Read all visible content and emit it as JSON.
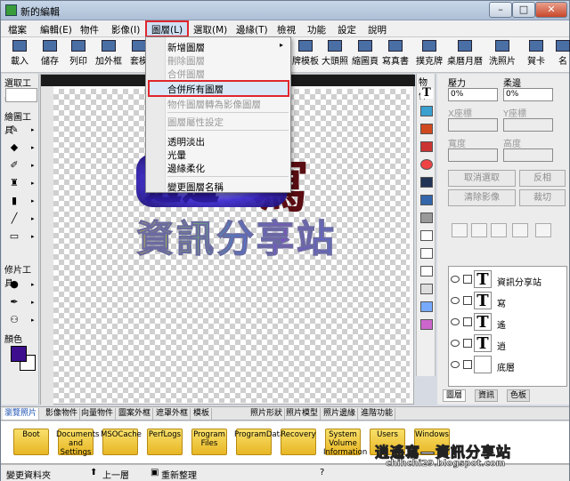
{
  "window": {
    "title": "新的編輯"
  },
  "menubar": [
    "檔案",
    "編輯(E)",
    "物件",
    "影像(I)",
    "圖層(L)",
    "選取(M)",
    "邊緣(T)",
    "檢視",
    "功能",
    "設定",
    "說明"
  ],
  "toolbar": [
    "載入",
    "儲存",
    "列印",
    "加外框",
    "套模",
    "牌模板",
    "大頭照",
    "縮圖頁",
    "寫真書",
    "撲克牌",
    "桌曆月曆",
    "洗照片",
    "賀卡",
    "名"
  ],
  "left_panel": {
    "select_title": "選取工具",
    "paint_title": "繪圖工具",
    "retouch_title": "修片工具",
    "color_title": "顏色"
  },
  "dropdown": {
    "items": [
      {
        "label": "新增圖層",
        "disabled": false,
        "submenu": true
      },
      {
        "label": "刪除圖層",
        "disabled": true
      },
      {
        "label": "合併圖層",
        "disabled": true
      },
      {
        "label": "合併所有圖層",
        "disabled": false,
        "highlighted": true
      },
      {
        "label": "物件圖層轉為影像圖層",
        "disabled": true
      },
      {
        "label": "圖層屬性設定",
        "disabled": true
      },
      {
        "label": "透明淡出",
        "disabled": false
      },
      {
        "label": "光暈",
        "disabled": false
      },
      {
        "label": "邊緣柔化",
        "disabled": false
      },
      {
        "label": "變更圖層名稱",
        "disabled": false
      }
    ]
  },
  "canvas": {
    "text": "資訊分享站",
    "shadow_glyph": "寫"
  },
  "side_icons": {
    "label": "物件"
  },
  "right_panel": {
    "opacity_label": "壓力",
    "opacity_val": "0%",
    "soft_label": "柔邊",
    "soft_val": "0%",
    "x_label": "X座標",
    "y_label": "Y座標",
    "w_label": "寬度",
    "h_label": "高度",
    "cancel_sel": "取消選取",
    "flip": "反相",
    "clear_img": "清除影像",
    "crop": "裁切",
    "layers": [
      {
        "name": "資訊分享站",
        "thumb": "T"
      },
      {
        "name": "寫",
        "thumb": "T"
      },
      {
        "name": "遙",
        "thumb": "T"
      },
      {
        "name": "逍",
        "thumb": "T"
      },
      {
        "name": "底層",
        "thumb": ""
      }
    ],
    "tabs": [
      "圖層",
      "資訊",
      "色板"
    ]
  },
  "bottom_tabs": [
    "瀏覽照片",
    "影像物件",
    "向量物件",
    "圖案外框",
    "遮罩外框",
    "模板",
    "照片形狀",
    "照片模型",
    "照片邊緣",
    "進階功能"
  ],
  "folders": [
    "Boot",
    "Documents and Settings",
    "MSOCache",
    "PerfLogs",
    "Program Files",
    "ProgramData",
    "Recovery",
    "System Volume Information",
    "Users",
    "Windows"
  ],
  "statusbar": {
    "left": "變更資料夾",
    "up": "上一層",
    "refresh": "重新整理",
    "q": "?"
  },
  "watermark": {
    "line1": "逍遙寫—資訊分享站",
    "line2": "chihchi29.blogspot.com"
  }
}
